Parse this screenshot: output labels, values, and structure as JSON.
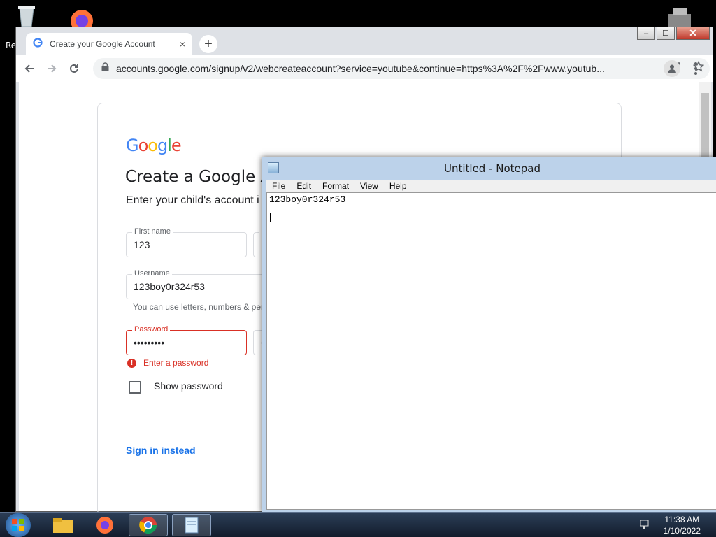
{
  "desktop": {
    "left_label": "Re"
  },
  "browser": {
    "tab_title": "Create your Google Account",
    "tab_close": "×",
    "new_tab": "+",
    "url": "accounts.google.com/signup/v2/webcreateaccount?service=youtube&continue=https%3A%2F%2Fwww.youtub...",
    "window_buttons": {
      "minimize": "–",
      "maximize": "☐",
      "close": "✕"
    }
  },
  "form": {
    "logo": "Google",
    "heading": "Create a Google A",
    "subheading": "Enter your child's account i",
    "first_name_label": "First name",
    "first_name_value": "123",
    "last_name_label": "L",
    "last_name_value": "1",
    "username_label": "Username",
    "username_value": "123boy0r324r53",
    "username_hint": "You can use letters, numbers & peri",
    "password_label": "Password",
    "password_value": "•••••••••",
    "confirm_fragment": "C",
    "password_error": "Enter a password",
    "show_password": "Show password",
    "sign_in": "Sign in instead"
  },
  "notepad": {
    "title": "Untitled - Notepad",
    "menu": [
      "File",
      "Edit",
      "Format",
      "View",
      "Help"
    ],
    "text": "123boy0r324r53"
  },
  "taskbar": {
    "time": "11:38 AM",
    "date": "1/10/2022"
  },
  "colors": {
    "google_blue": "#4285f4",
    "google_red": "#ea4335",
    "google_yellow": "#fbbc05",
    "google_green": "#34a853",
    "error_red": "#d93025",
    "link_blue": "#1a73e8"
  }
}
